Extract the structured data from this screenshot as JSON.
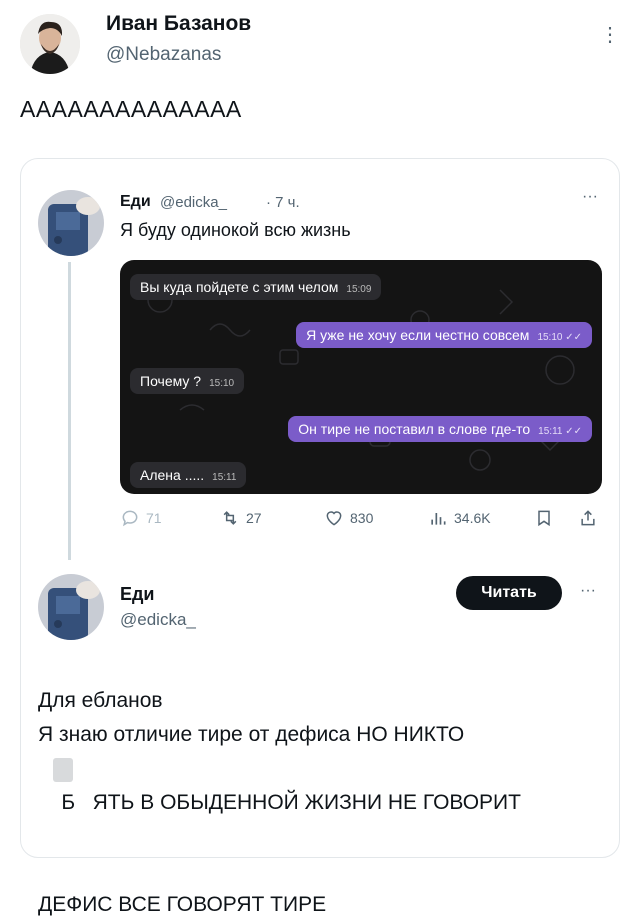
{
  "post": {
    "author_name": "Иван Базанов",
    "author_handle": "@Nebazanas",
    "more": "⋮",
    "text": "АААААААААААААА"
  },
  "quote": {
    "tweet1": {
      "name": "Еди",
      "handle": "@edicka_",
      "time": "· 7 ч.",
      "more": "···",
      "text": "Я буду одинокой всю жизнь"
    },
    "chat": [
      {
        "side": "in",
        "text": "Вы куда пойдете с этим челом",
        "time": "15:09"
      },
      {
        "side": "out",
        "text": "Я уже не хочу если честно совсем",
        "time": "15:10 ✓✓"
      },
      {
        "side": "in",
        "text": "Почему ?",
        "time": "15:10"
      },
      {
        "side": "out",
        "text": "Он тире не поставил в слове где-то",
        "time": "15:11 ✓✓"
      },
      {
        "side": "in",
        "text": "Алена .....",
        "time": "15:11"
      }
    ],
    "actions": {
      "replies": "71",
      "retweets": "27",
      "likes": "830",
      "views": "34.6K"
    },
    "tweet2": {
      "name": "Еди",
      "handle": "@edicka_",
      "follow_label": "Читать",
      "more": "···",
      "lines": [
        "Для ебланов",
        "Я знаю отличие тире от дефиса НО НИКТО",
        "Б   ЯТЬ В ОБЫДЕННОЙ ЖИЗНИ НЕ ГОВОРИТ",
        "ДЕФИС ВСЕ ГОВОРЯТ ТИРЕ"
      ]
    }
  },
  "colors": {
    "accent_purple": "#7b5cc9",
    "chat_bg": "#141414",
    "muted": "#536471"
  }
}
